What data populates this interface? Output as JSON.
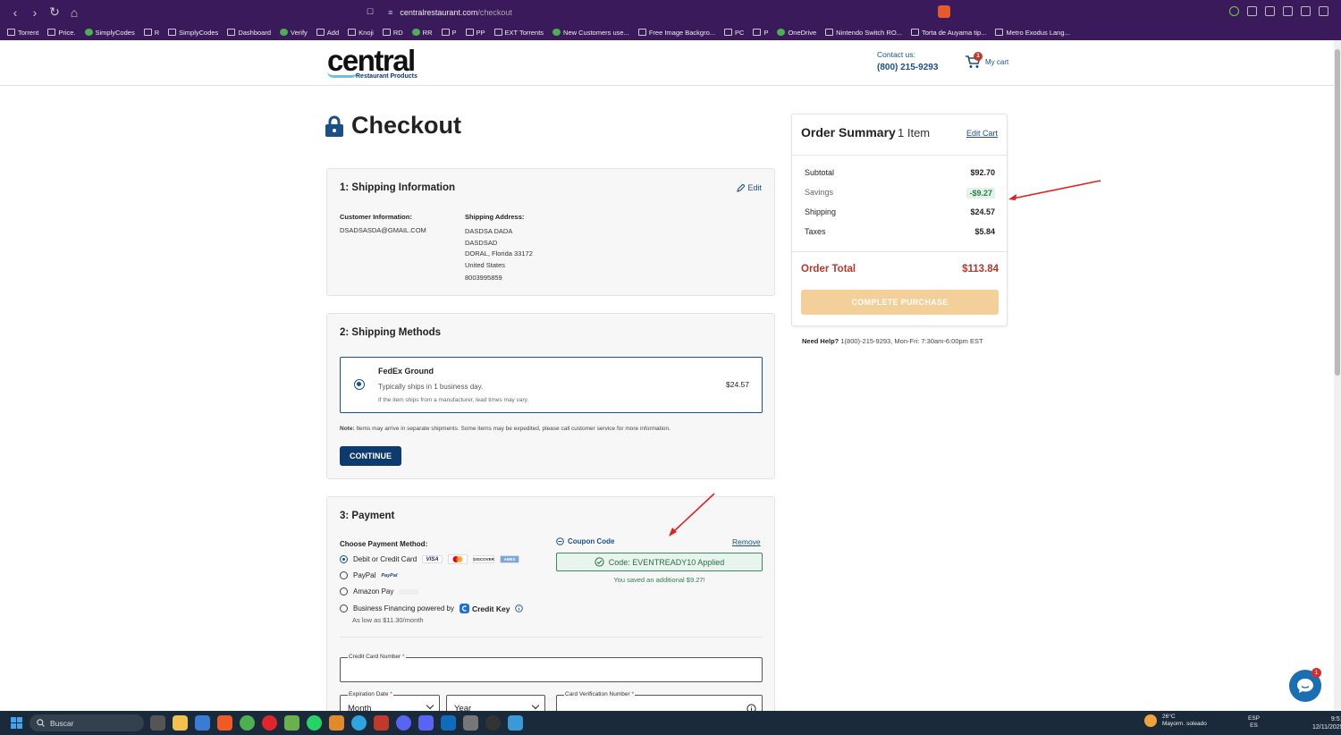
{
  "browser": {
    "url_domain": "centralrestaurant.com",
    "url_path": "/checkout",
    "bookmarks": [
      "Torrent",
      "Price.",
      "SimplyCodes",
      "R",
      "SimplyCodes",
      "Dashboard",
      "Verify",
      "Add",
      "Knoji",
      "RD",
      "RR",
      "P",
      "PP",
      "EXT Torrents",
      "New Customers use...",
      "Free Image Backgro...",
      "PC",
      "P",
      "OneDrive",
      "Nintendo Switch RO...",
      "Torta de Auyama tip...",
      "Metro Exodus Lang..."
    ]
  },
  "header": {
    "logo_word": "central",
    "logo_sub": "Restaurant Products",
    "contact_label": "Contact us:",
    "contact_phone": "(800) 215-9293",
    "cart_count": "1",
    "cart_label": "My cart"
  },
  "checkout": {
    "title": "Checkout",
    "shipping_info": {
      "title": "1: Shipping Information",
      "edit_label": "Edit",
      "customer_label": "Customer Information:",
      "customer_email": "DSADSASDA@GMAIL.COM",
      "address_label": "Shipping Address:",
      "address_lines": [
        "DASDSA DADA",
        "DASDSAD",
        "DORAL, Florida 33172",
        "United States",
        "8003995859"
      ]
    },
    "shipping_methods": {
      "title": "2: Shipping Methods",
      "method_name": "FedEx Ground",
      "method_desc": "Typically ships in 1 business day.",
      "method_note": "If the item ships from a manufacturer, lead times may vary.",
      "method_price": "$24.57",
      "note_label": "Note:",
      "note_text": "Items may arrive in separate shipments. Some items may be expedited, please call customer service for more information.",
      "continue_label": "CONTINUE"
    },
    "payment": {
      "title": "3: Payment",
      "choose_label": "Choose Payment Method:",
      "options": [
        "Debit or Credit Card",
        "PayPal",
        "Amazon Pay",
        "Business Financing powered by"
      ],
      "selected": "Debit or Credit Card",
      "credit_key_label": "Credit Key",
      "financing_note": "As low as $11.30/month",
      "card_logos": [
        "VISA",
        "MC",
        "DISCOVER",
        "AMEX"
      ],
      "paypal_logo": "PayPal",
      "coupon_label": "Coupon Code",
      "remove_label": "Remove",
      "coupon_applied": "Code: EVENTREADY10 Applied",
      "coupon_code": "EVENTREADY10",
      "saved_note": "You saved an additional $9.27!",
      "card_number_label": "Credit Card Number",
      "expiration_label": "Expiration Date",
      "month_placeholder": "Month",
      "year_placeholder": "Year",
      "cvv_label": "Card Verification Number",
      "required_mark": "*"
    }
  },
  "summary": {
    "title": "Order Summary",
    "item_count": "1 Item",
    "edit_cart": "Edit Cart",
    "rows": [
      {
        "label": "Subtotal",
        "value": "$92.70"
      },
      {
        "label": "Savings",
        "value": "-$9.27"
      },
      {
        "label": "Shipping",
        "value": "$24.57"
      },
      {
        "label": "Taxes",
        "value": "$5.84"
      }
    ],
    "total_label": "Order Total",
    "total_value": "$113.84",
    "complete_label": "COMPLETE PURCHASE",
    "help_bold": "Need Help?",
    "help_text": "1(800)-215-9293, Mon-Fri: 7:30am-6:00pm EST"
  },
  "chat": {
    "badge": "1"
  },
  "taskbar": {
    "search_placeholder": "Buscar",
    "weather_temp": "26°C",
    "weather_desc": "Mayorm. soleado",
    "lang_top": "ESP",
    "lang_bottom": "ES",
    "time": "9:51",
    "date": "12/11/2025"
  },
  "colors": {
    "accent": "#0d3b70",
    "total_red": "#b03a2e",
    "savings_green": "#2e7d4f",
    "complete_button": "#f3cf99",
    "browser_chrome": "#3b1a5c"
  }
}
